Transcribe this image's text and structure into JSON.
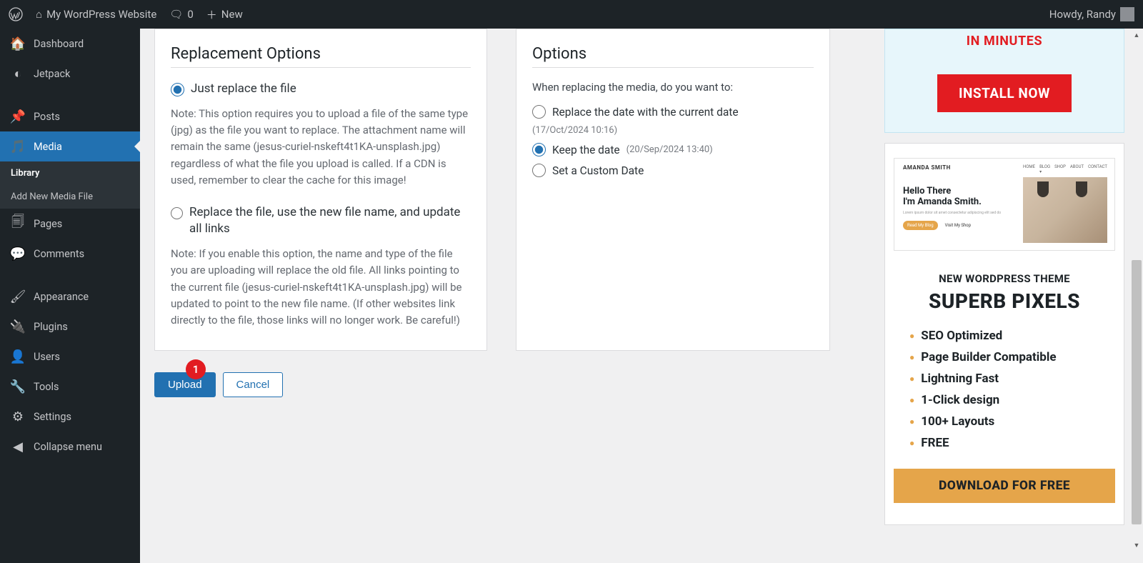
{
  "adminbar": {
    "site_name": "My WordPress Website",
    "comments_count": "0",
    "new_label": "New",
    "howdy": "Howdy, Randy"
  },
  "sidebar": {
    "items": [
      {
        "label": "Dashboard",
        "icon": "⌂"
      },
      {
        "label": "Jetpack",
        "icon": "◎"
      },
      {
        "label": "Posts",
        "icon": "📌"
      },
      {
        "label": "Media",
        "icon": "🎵",
        "current": true
      },
      {
        "label": "Pages",
        "icon": "🗐"
      },
      {
        "label": "Comments",
        "icon": "💬"
      },
      {
        "label": "Appearance",
        "icon": "🖌"
      },
      {
        "label": "Plugins",
        "icon": "🔌"
      },
      {
        "label": "Users",
        "icon": "👤"
      },
      {
        "label": "Tools",
        "icon": "🔧"
      },
      {
        "label": "Settings",
        "icon": "⚙"
      }
    ],
    "media_submenu": {
      "library": "Library",
      "add_new": "Add New Media File"
    },
    "collapse": "Collapse menu"
  },
  "main": {
    "replacement": {
      "heading": "Replacement Options",
      "opt1_label": "Just replace the file",
      "opt1_note": "Note: This option requires you to upload a file of the same type (jpg) as the file you want to replace. The attachment name will remain the same (jesus-curiel-nskeft4t1KA-unsplash.jpg) regardless of what the file you upload is called. If a CDN is used, remember to clear the cache for this image!",
      "opt2_label": "Replace the file, use the new file name, and update all links",
      "opt2_note": "Note: If you enable this option, the name and type of the file you are uploading will replace the old file. All links pointing to the current file (jesus-curiel-nskeft4t1KA-unsplash.jpg) will be updated to point to the new file name. (If other websites link directly to the file, those links will no longer work. Be careful!)"
    },
    "options": {
      "heading": "Options",
      "intro": "When replacing the media, do you want to:",
      "opt1_label": "Replace the date with the current date",
      "opt1_date": "(17/Oct/2024 10:16)",
      "opt2_label": "Keep the date",
      "opt2_date": "(20/Sep/2024 13:40)",
      "opt3_label": "Set a Custom Date"
    },
    "buttons": {
      "upload": "Upload",
      "cancel": "Cancel",
      "badge": "1"
    }
  },
  "promo": {
    "top_headline": "IN MINUTES",
    "install": "INSTALL NOW",
    "theme": {
      "brand": "AMANDA SMITH",
      "nav": [
        "HOME",
        "BLOG ▾",
        "SHOP",
        "ABOUT",
        "CONTACT"
      ],
      "h1a": "Hello There",
      "h1b": "I'm Amanda Smith.",
      "btn1": "Read My Blog",
      "btn2": "Visit My Shop"
    },
    "t1": "NEW WORDPRESS THEME",
    "t2": "SUPERB PIXELS",
    "features": [
      "SEO Optimized",
      "Page Builder Compatible",
      "Lightning Fast",
      "1-Click design",
      "100+ Layouts",
      "FREE"
    ],
    "download": "DOWNLOAD FOR FREE"
  }
}
